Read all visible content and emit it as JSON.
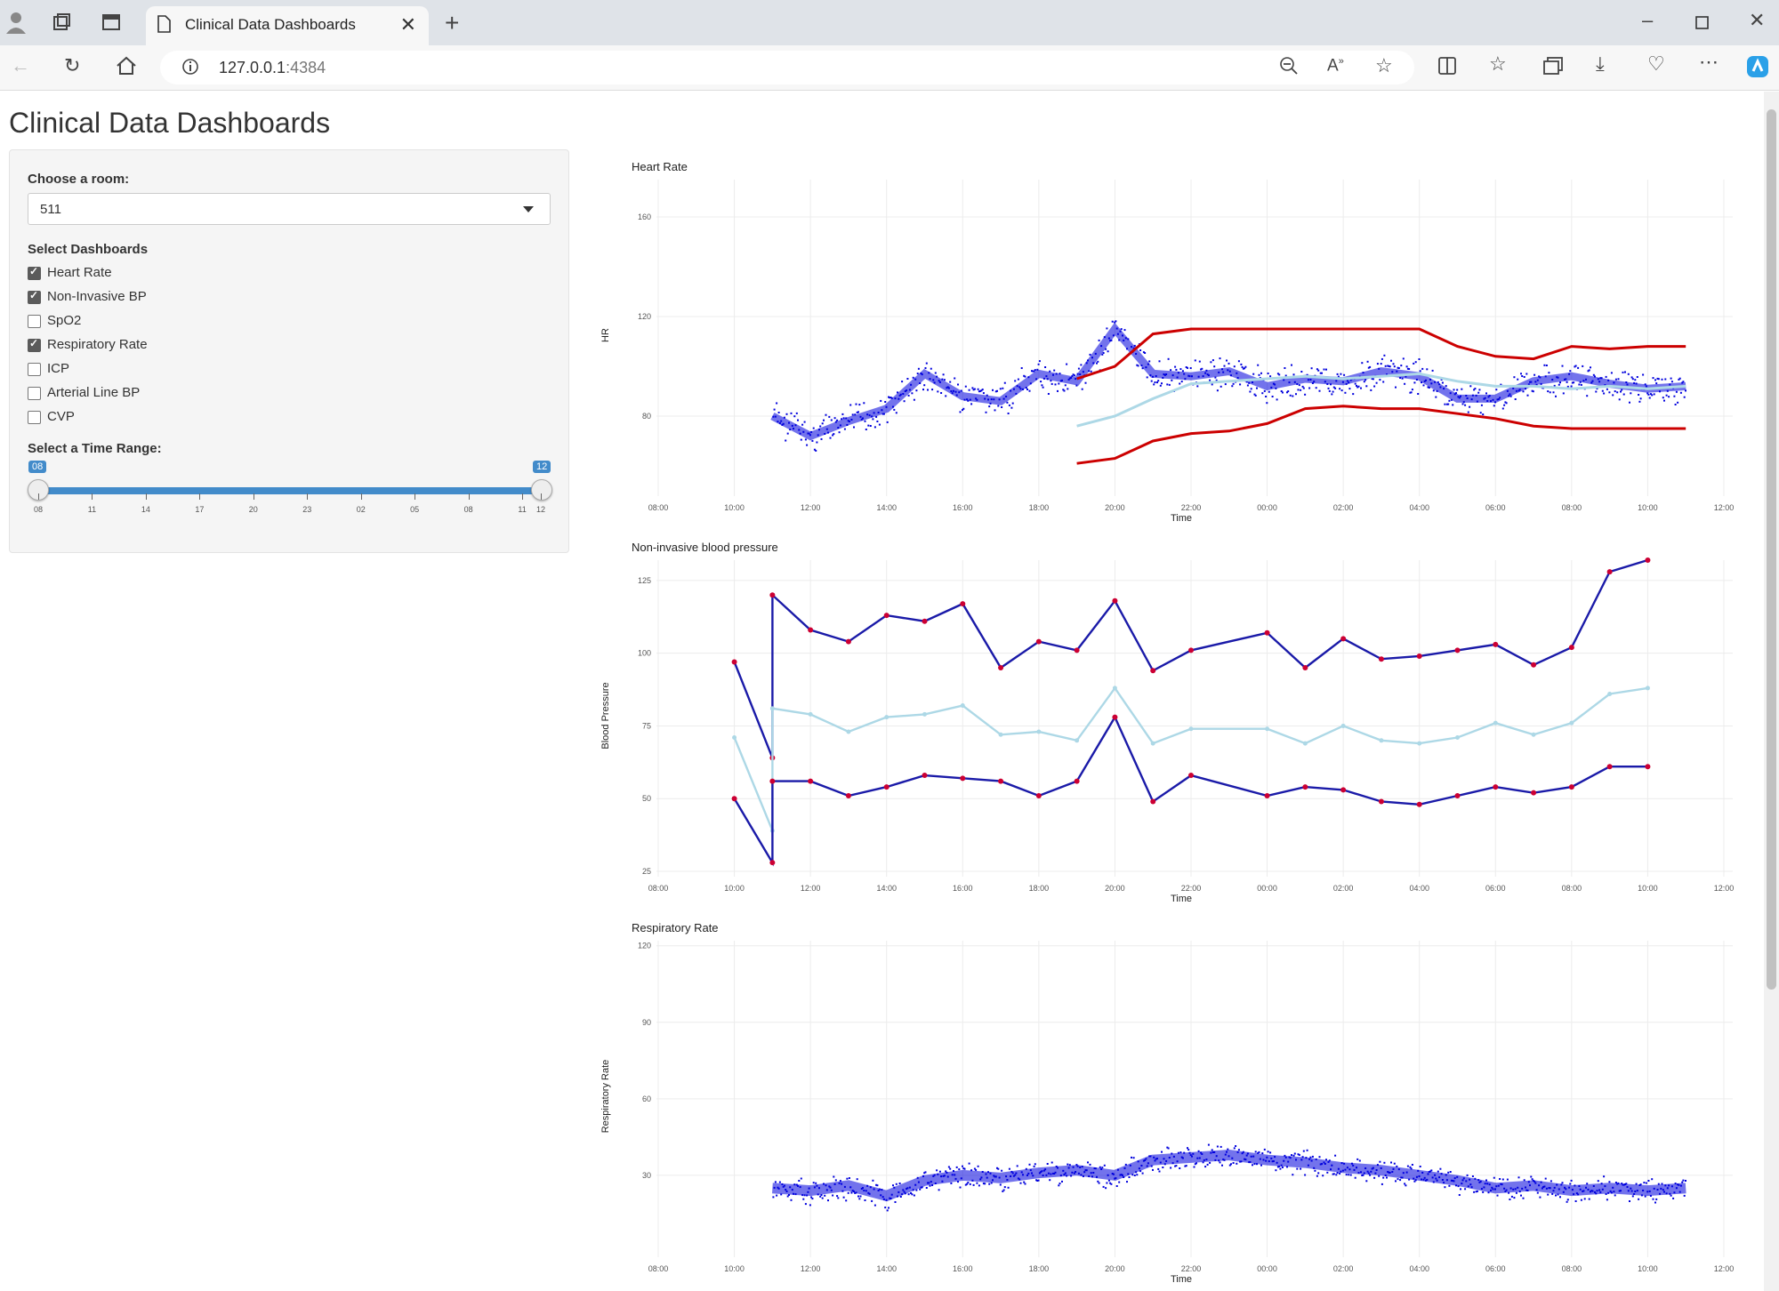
{
  "browser": {
    "tab_title": "Clinical Data Dashboards",
    "url_host": "127.0.0.1",
    "url_port": ":4384"
  },
  "page": {
    "title": "Clinical Data Dashboards"
  },
  "sidebar": {
    "room_label": "Choose a room:",
    "room_value": "511",
    "dash_label": "Select Dashboards",
    "dashboards": [
      {
        "label": "Heart Rate",
        "checked": true
      },
      {
        "label": "Non-Invasive BP",
        "checked": true
      },
      {
        "label": "SpO2",
        "checked": false
      },
      {
        "label": "Respiratory Rate",
        "checked": true
      },
      {
        "label": "ICP",
        "checked": false
      },
      {
        "label": "Arterial Line BP",
        "checked": false
      },
      {
        "label": "CVP",
        "checked": false
      }
    ],
    "time_label": "Select a Time Range:",
    "time_min": "08",
    "time_max": "12",
    "time_ticks": [
      "08",
      "11",
      "14",
      "17",
      "20",
      "23",
      "02",
      "05",
      "08",
      "11",
      "12"
    ]
  },
  "chart_data": [
    {
      "type": "scatter",
      "title": "Heart Rate",
      "xlabel": "Time",
      "ylabel": "HR",
      "x_ticks": [
        "08:00",
        "10:00",
        "12:00",
        "14:00",
        "16:00",
        "18:00",
        "20:00",
        "22:00",
        "00:00",
        "02:00",
        "04:00",
        "06:00",
        "08:00",
        "10:00",
        "12:00"
      ],
      "y_ticks": [
        80,
        120,
        160
      ],
      "ylim": [
        50,
        175
      ],
      "series": [
        {
          "values": [
            [
              11,
              80
            ],
            [
              12,
              72
            ],
            [
              13,
              78
            ],
            [
              14,
              83
            ],
            [
              15,
              97
            ],
            [
              16,
              88
            ],
            [
              17,
              86
            ],
            [
              18,
              97
            ],
            [
              19,
              94
            ],
            [
              20,
              115
            ],
            [
              21,
              97
            ],
            [
              22,
              96
            ],
            [
              23,
              98
            ],
            [
              0,
              92
            ],
            [
              1,
              95
            ],
            [
              2,
              94
            ],
            [
              3,
              98
            ],
            [
              4,
              96
            ],
            [
              5,
              87
            ],
            [
              6,
              87
            ],
            [
              7,
              94
            ],
            [
              8,
              96
            ],
            [
              9,
              93
            ],
            [
              10,
              91
            ],
            [
              11,
              92
            ]
          ],
          "color": "#0000dd"
        },
        {
          "values": [
            [
              19,
              76
            ],
            [
              20,
              80
            ],
            [
              21,
              87
            ],
            [
              22,
              93
            ],
            [
              23,
              94
            ],
            [
              0,
              95
            ],
            [
              1,
              96
            ],
            [
              2,
              95
            ],
            [
              3,
              96
            ],
            [
              4,
              97
            ],
            [
              5,
              94
            ],
            [
              6,
              92
            ],
            [
              7,
              92
            ],
            [
              8,
              91
            ],
            [
              9,
              92
            ],
            [
              10,
              91
            ],
            [
              11,
              92
            ]
          ],
          "color": "#add8e6"
        },
        {
          "values": [
            [
              19,
              95
            ],
            [
              20,
              100
            ],
            [
              21,
              113
            ],
            [
              22,
              115
            ],
            [
              23,
              115
            ],
            [
              0,
              115
            ],
            [
              1,
              115
            ],
            [
              2,
              115
            ],
            [
              3,
              115
            ],
            [
              4,
              115
            ],
            [
              5,
              108
            ],
            [
              6,
              104
            ],
            [
              7,
              103
            ],
            [
              8,
              108
            ],
            [
              9,
              107
            ],
            [
              10,
              108
            ],
            [
              11,
              108
            ]
          ],
          "color": "#cc0000"
        },
        {
          "values": [
            [
              19,
              61
            ],
            [
              20,
              63
            ],
            [
              21,
              70
            ],
            [
              22,
              73
            ],
            [
              23,
              74
            ],
            [
              0,
              77
            ],
            [
              1,
              83
            ],
            [
              2,
              84
            ],
            [
              3,
              83
            ],
            [
              4,
              83
            ],
            [
              5,
              81
            ],
            [
              6,
              79
            ],
            [
              7,
              76
            ],
            [
              8,
              75
            ],
            [
              9,
              75
            ],
            [
              10,
              75
            ],
            [
              11,
              75
            ]
          ],
          "color": "#cc0000"
        }
      ]
    },
    {
      "type": "line",
      "title": "Non-invasive blood pressure",
      "xlabel": "Time",
      "ylabel": "Blood Pressure",
      "x_ticks": [
        "08:00",
        "10:00",
        "12:00",
        "14:00",
        "16:00",
        "18:00",
        "20:00",
        "22:00",
        "00:00",
        "02:00",
        "04:00",
        "06:00",
        "08:00",
        "10:00",
        "12:00"
      ],
      "y_ticks": [
        25,
        50,
        75,
        100,
        125
      ],
      "ylim": [
        25,
        132
      ],
      "series": [
        {
          "values": [
            [
              10,
              97
            ],
            [
              11,
              64
            ],
            [
              11,
              120
            ],
            [
              12,
              108
            ],
            [
              13,
              104
            ],
            [
              14,
              113
            ],
            [
              15,
              111
            ],
            [
              16,
              117
            ],
            [
              17,
              95
            ],
            [
              18,
              104
            ],
            [
              19,
              101
            ],
            [
              20,
              118
            ],
            [
              21,
              94
            ],
            [
              22,
              101
            ],
            [
              0,
              107
            ],
            [
              1,
              95
            ],
            [
              2,
              105
            ],
            [
              3,
              98
            ],
            [
              4,
              99
            ],
            [
              5,
              101
            ],
            [
              6,
              103
            ],
            [
              7,
              96
            ],
            [
              8,
              102
            ],
            [
              9,
              128
            ],
            [
              10,
              132
            ]
          ],
          "color": "#1a1aa8"
        },
        {
          "values": [
            [
              10,
              71
            ],
            [
              11,
              39
            ],
            [
              11,
              81
            ],
            [
              12,
              79
            ],
            [
              13,
              73
            ],
            [
              14,
              78
            ],
            [
              15,
              79
            ],
            [
              16,
              82
            ],
            [
              17,
              72
            ],
            [
              18,
              73
            ],
            [
              19,
              70
            ],
            [
              20,
              88
            ],
            [
              21,
              69
            ],
            [
              22,
              74
            ],
            [
              0,
              74
            ],
            [
              1,
              69
            ],
            [
              2,
              75
            ],
            [
              3,
              70
            ],
            [
              4,
              69
            ],
            [
              5,
              71
            ],
            [
              6,
              76
            ],
            [
              7,
              72
            ],
            [
              8,
              76
            ],
            [
              9,
              86
            ],
            [
              10,
              88
            ]
          ],
          "color": "#add8e6"
        },
        {
          "values": [
            [
              10,
              50
            ],
            [
              11,
              28
            ],
            [
              11,
              56
            ],
            [
              12,
              56
            ],
            [
              13,
              51
            ],
            [
              14,
              54
            ],
            [
              15,
              58
            ],
            [
              16,
              57
            ],
            [
              17,
              56
            ],
            [
              18,
              51
            ],
            [
              19,
              56
            ],
            [
              20,
              78
            ],
            [
              21,
              49
            ],
            [
              22,
              58
            ],
            [
              0,
              51
            ],
            [
              1,
              54
            ],
            [
              2,
              53
            ],
            [
              3,
              49
            ],
            [
              4,
              48
            ],
            [
              5,
              51
            ],
            [
              6,
              54
            ],
            [
              7,
              52
            ],
            [
              8,
              54
            ],
            [
              9,
              61
            ],
            [
              10,
              61
            ]
          ],
          "color": "#1a1aa8"
        }
      ]
    },
    {
      "type": "scatter",
      "title": "Respiratory Rate",
      "xlabel": "Time",
      "ylabel": "Respiratory Rate",
      "x_ticks": [
        "08:00",
        "10:00",
        "12:00",
        "14:00",
        "16:00",
        "18:00",
        "20:00",
        "22:00",
        "00:00",
        "02:00",
        "04:00",
        "06:00",
        "08:00",
        "10:00",
        "12:00"
      ],
      "y_ticks": [
        30,
        60,
        90,
        120
      ],
      "ylim": [
        0,
        122
      ],
      "series": [
        {
          "values": [
            [
              11,
              25
            ],
            [
              12,
              24
            ],
            [
              13,
              26
            ],
            [
              14,
              22
            ],
            [
              15,
              28
            ],
            [
              16,
              30
            ],
            [
              17,
              29
            ],
            [
              18,
              31
            ],
            [
              19,
              32
            ],
            [
              20,
              30
            ],
            [
              21,
              36
            ],
            [
              22,
              37
            ],
            [
              23,
              38
            ],
            [
              0,
              36
            ],
            [
              1,
              35
            ],
            [
              2,
              33
            ],
            [
              3,
              32
            ],
            [
              4,
              30
            ],
            [
              5,
              28
            ],
            [
              6,
              25
            ],
            [
              7,
              26
            ],
            [
              8,
              24
            ],
            [
              9,
              25
            ],
            [
              10,
              24
            ],
            [
              11,
              25
            ]
          ],
          "color": "#0000dd"
        }
      ]
    }
  ]
}
